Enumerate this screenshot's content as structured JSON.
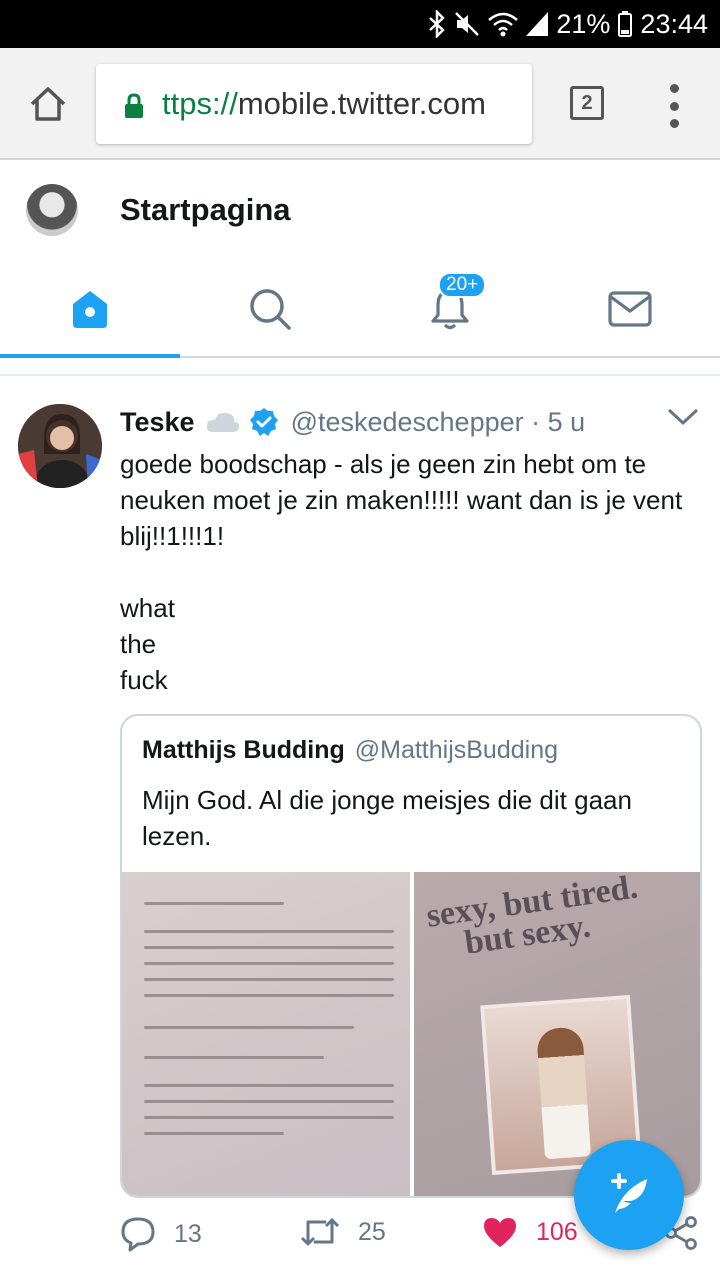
{
  "status_bar": {
    "battery": "21%",
    "time": "23:44"
  },
  "browser": {
    "url_scheme": "ttps://",
    "url_host": "mobile.twitter.com",
    "tab_count": "2"
  },
  "header": {
    "title": "Startpagina"
  },
  "nav": {
    "notifications_badge": "20+"
  },
  "tweet": {
    "author_name": "Teske",
    "handle": "@teskedeschepper",
    "separator": " · ",
    "time": "5 u",
    "text": "goede boodschap - als je geen zin hebt om te neuken moet je zin maken!!!!! want dan is je vent blij!!1!!!1!\n\nwhat\nthe\nfuck",
    "quote": {
      "author_name": "Matthijs Budding",
      "handle": "@MatthijsBudding",
      "text": "Mijn God. Al die jonge meisjes die dit gaan lezen."
    },
    "replies": "13",
    "retweets": "25",
    "likes": "106"
  },
  "colors": {
    "accent": "#1da1f2",
    "like": "#e0245e",
    "secondary_text": "#657786",
    "lock_green": "#0b8043"
  }
}
